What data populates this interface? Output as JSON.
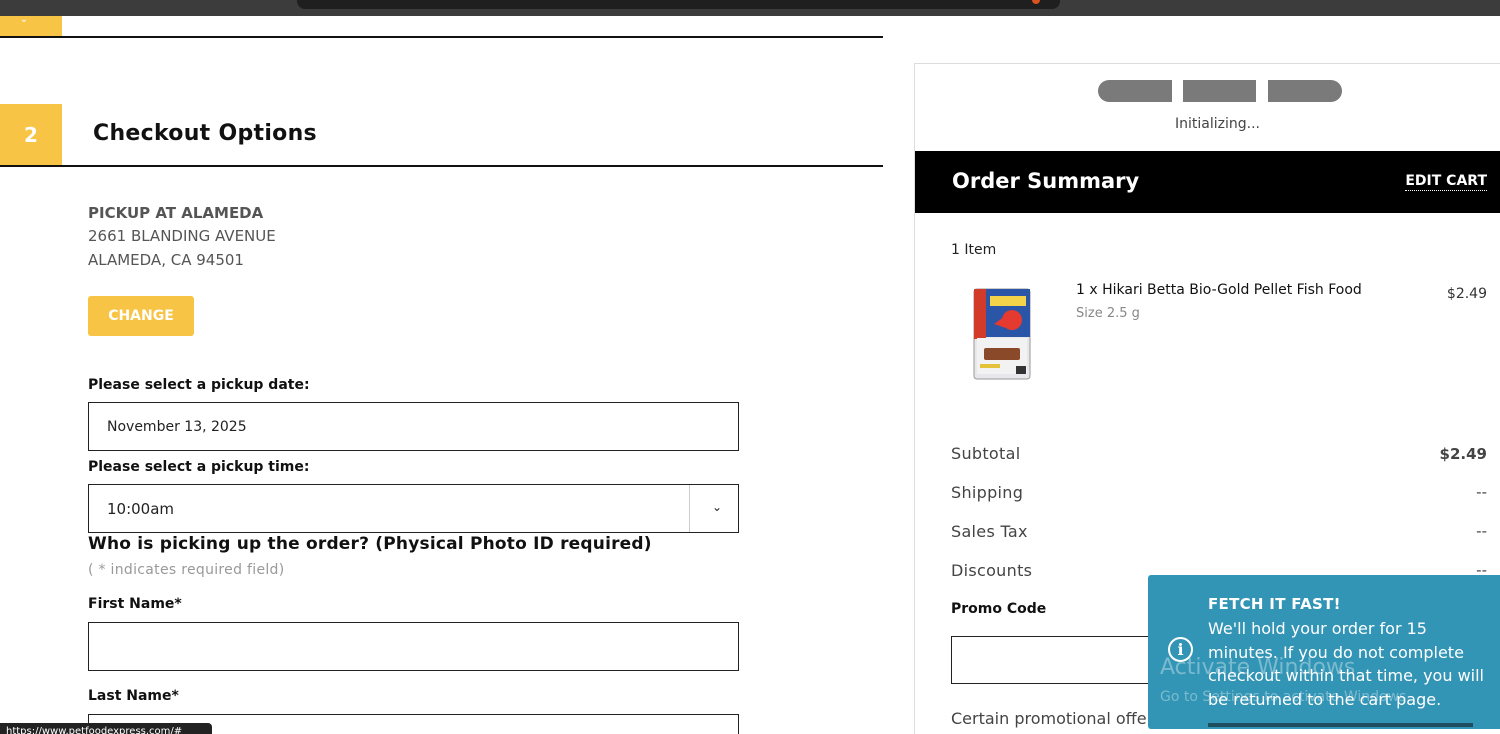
{
  "step1": {
    "chevron": "⌄"
  },
  "step2": {
    "number": "2",
    "title": "Checkout Options"
  },
  "pickup": {
    "name": "PICKUP AT ALAMEDA",
    "address_line1": "2661 BLANDING AVENUE",
    "address_line2": "ALAMEDA, CA 94501",
    "change_label": "CHANGE"
  },
  "date": {
    "label": "Please select a pickup date:",
    "value": "November 13, 2025"
  },
  "time": {
    "label": "Please select a pickup time:",
    "value": "10:00am",
    "chevron": "⌄"
  },
  "pickup_person": {
    "title": "Who is picking up the order? (Physical Photo ID required)",
    "required_note": "( * indicates required field)",
    "first_name_label": "First Name*",
    "last_name_label": "Last Name*"
  },
  "status_url": "https://www.petfoodexpress.com/#",
  "payment": {
    "status": "Initializing..."
  },
  "summary": {
    "title": "Order Summary",
    "edit_cart": "EDIT CART",
    "item_count": "1 Item",
    "item": {
      "name": "1 x Hikari Betta Bio-Gold Pellet Fish Food",
      "size": "Size 2.5 g",
      "price": "$2.49"
    },
    "subtotal_label": "Subtotal",
    "subtotal_value": "$2.49",
    "shipping_label": "Shipping",
    "shipping_value": "--",
    "tax_label": "Sales Tax",
    "tax_value": "--",
    "discounts_label": "Discounts",
    "discounts_value": "--",
    "promo_label": "Promo Code",
    "promo_note": "Certain promotional offe"
  },
  "toast": {
    "title": "FETCH IT FAST!",
    "message": "We'll hold your order for 15 minutes. If you do not complete checkout within that time, you will be returned to the cart page.",
    "icon": "i"
  },
  "watermark": {
    "title": "Activate Windows",
    "subtitle": "Go to Settings to activate Windows."
  },
  "colors": {
    "accent": "#f8c445",
    "toast": "#3395b5",
    "summary_bar": "#000000"
  }
}
